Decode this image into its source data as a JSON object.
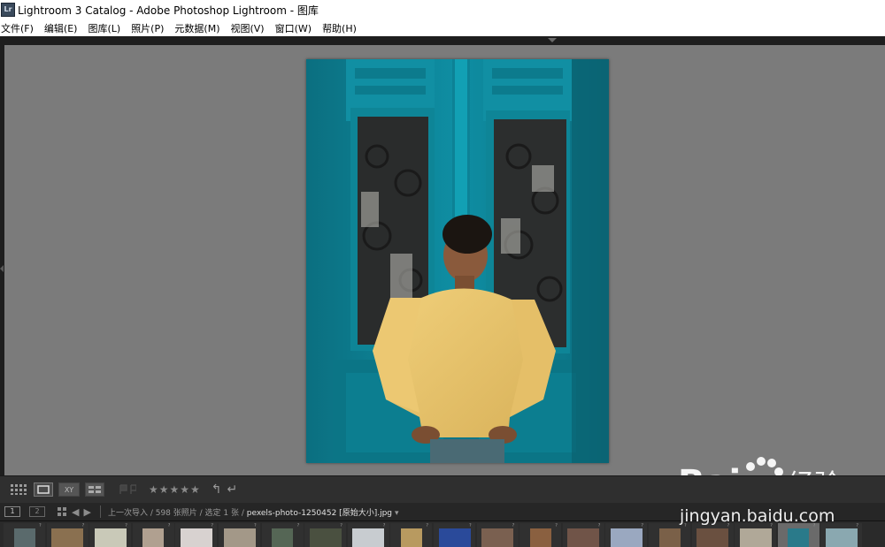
{
  "window": {
    "title": "Lightroom 3 Catalog - Adobe Photoshop Lightroom - 图库",
    "app_icon_text": "Lr"
  },
  "menubar": {
    "items": [
      "文件(F)",
      "编辑(E)",
      "图库(L)",
      "照片(P)",
      "元数据(M)",
      "视图(V)",
      "窗口(W)",
      "帮助(H)"
    ]
  },
  "toolbar": {
    "compare_label": "XY",
    "rating": "★★★★★",
    "rotate_left": "↰",
    "rotate_right": "↵"
  },
  "filmstrip_nav": {
    "screen_1": "1",
    "screen_2": "2",
    "source": "上一次导入",
    "sep1": " / ",
    "photo_count": "598 张照片",
    "sep2": " / ",
    "selected": "选定 1 张",
    "sep3": " / ",
    "filename": "pexels-photo-1250452 [原始大小].jpg",
    "dropdown": "▾"
  },
  "filmstrip": {
    "thumb_colors": [
      "#5a6a6c",
      "#8a7050",
      "#c9c9b8",
      "#b0a090",
      "#d8d2d0",
      "#a39888",
      "#556655",
      "#4a5040",
      "#c8ccd0",
      "#b89a60",
      "#2a4a9a",
      "#7a6050",
      "#8a6040",
      "#705448",
      "#9aa8c0",
      "#7a6048",
      "#6a5040",
      "#b0a898",
      "#2a7a8a",
      "#8aa8b0"
    ],
    "active_index": 18
  },
  "watermark": {
    "brand": "Bai",
    "brand_suffix": "经验",
    "url": "jingyan.baidu.com"
  }
}
